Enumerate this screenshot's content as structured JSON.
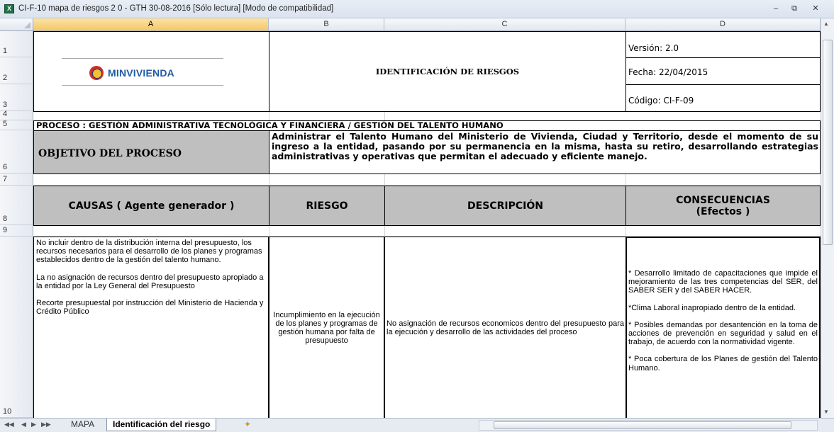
{
  "window": {
    "title": "CI-F-10 mapa de riesgos 2 0 - GTH 30-08-2016  [Sólo lectura]  [Modo de compatibilidad]",
    "app_icon": "excel-icon"
  },
  "columns": [
    "A",
    "B",
    "C",
    "D"
  ],
  "rows": [
    "1",
    "2",
    "3",
    "4",
    "5",
    "6",
    "7",
    "8",
    "9",
    "10"
  ],
  "header": {
    "logo_text": "MINVIVIENDA",
    "doc_title": "IDENTIFICACIÓN DE RIESGOS",
    "version": "Versión: 2.0",
    "fecha": "Fecha: 22/04/2015",
    "codigo": "Código: CI-F-09"
  },
  "proceso": "PROCESO :  GESTIÓN ADMINISTRATIVA TECNOLÓGICA Y FINANCIERA / GESTIÓN DEL TALENTO HUMANO",
  "objetivo": {
    "label": "OBJETIVO DEL PROCESO",
    "text": "Administrar el Talento Humano del Ministerio de Vivienda, Ciudad y Territorio, desde el momento de su ingreso a la entidad, pasando por su permanencia en la misma, hasta su retiro, desarrollando estrategias administrativas y operativas que permitan el adecuado y eficiente manejo."
  },
  "table_headers": {
    "causas": "CAUSAS ( Agente generador )",
    "riesgo": "RIESGO",
    "descripcion": "DESCRIPCIÓN",
    "consecuencias_1": "CONSECUENCIAS",
    "consecuencias_2": "(Efectos )"
  },
  "row10": {
    "causas_1": "No incluir dentro de la distribución interna del presupuesto, los recursos necesarios para el desarrollo de los planes y programas establecidos dentro de la gestión del talento humano.",
    "causas_2": "La no asignación de recursos dentro del presupuesto apropiado a la entidad por la Ley General del Presupuesto",
    "causas_3": "Recorte presupuestal por instrucción del Ministerio de Hacienda y Crédito Público",
    "riesgo": "Incumplimiento en la ejecución de los planes y programas de gestión humana por falta de presupuesto",
    "descripcion": "No asignación de recursos economicos dentro del presupuesto para la ejecución y desarrollo de las actividades del proceso",
    "cons_1": "* Desarrollo limitado de capacitaciones que impide el mejoramiento de las tres competencias del SER, del SABER SER y del SABER HACER.",
    "cons_2": "*Clima Laboral inapropiado dentro de la entidad.",
    "cons_3": "* Posibles demandas por desantención en la toma de acciones de prevención en seguridad y salud en el trabajo, de acuerdo con la normatividad vigente.",
    "cons_4": "* Poca cobertura de los Planes de gestión del Talento Humano."
  },
  "sheet_tabs": [
    "MAPA",
    "Identificación del riesgo"
  ],
  "active_tab": "Identificación del riesgo"
}
